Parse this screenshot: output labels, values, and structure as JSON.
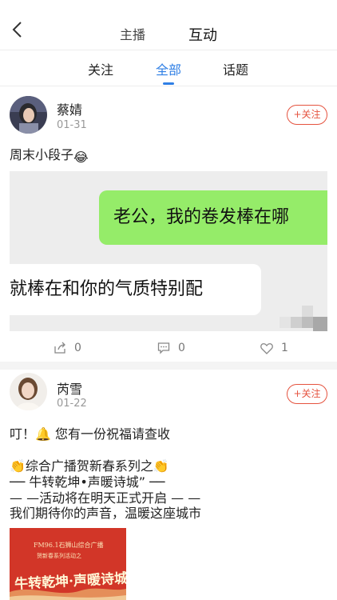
{
  "header": {
    "tabs": [
      {
        "label": "主播"
      },
      {
        "label": "互动"
      }
    ]
  },
  "subtabs": [
    {
      "label": "关注"
    },
    {
      "label": "全部"
    },
    {
      "label": "话题"
    }
  ],
  "posts": [
    {
      "author": "蔡婧",
      "date": "01-31",
      "follow_label": "+关注",
      "text": "周末小段子",
      "text_emoji": "😂",
      "image": {
        "bubble_green": "老公，我的卷发棒在哪",
        "bubble_white": "就棒在和你的气质特别配"
      },
      "actions": {
        "share": "0",
        "comment": "0",
        "like": "1"
      }
    },
    {
      "author": "芮雪",
      "date": "01-22",
      "follow_label": "+关注",
      "lines": [
        "叮！🔔 您有一份祝福请查收",
        "👏综合广播贺新春系列之👏",
        "── 牛转乾坤•声暖诗城” ──",
        "— —活动将在明天正式开启 — —",
        "我们期待你的声音，温暖这座城市"
      ],
      "poster": {
        "line1": "FM96.1石狮山综合广播",
        "line2": "贺新春系列活动之",
        "title": "牛转乾坤·声暖诗城"
      }
    }
  ],
  "colors": {
    "accent": "#2f7fe5",
    "follow": "#e5533f",
    "chat_green": "#95ec69"
  }
}
